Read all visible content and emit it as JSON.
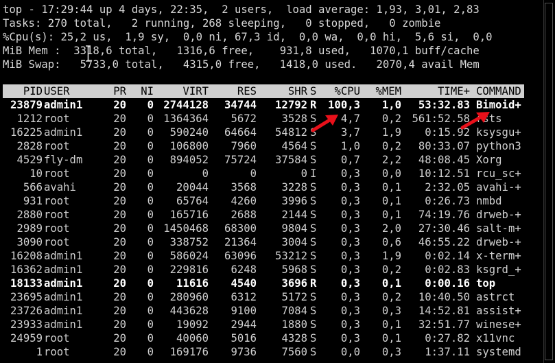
{
  "summary": {
    "line1": "top - 17:29:44 up 4 days, 22:35,  2 users,  load average: 1,93, 3,01, 2,83",
    "line2": "Tasks: 270 total,   2 running, 268 sleeping,   0 stopped,   0 zombie",
    "line3": "%Cpu(s): 25,2 us,  1,9 sy,  0,0 ni, 67,3 id,  0,0 wa,  0,0 hi,  5,6 si,  0,0",
    "line4": "MiB Mem :  3318,6 total,   1316,6 free,    931,8 used,   1070,1 buff/cache",
    "line5": "MiB Swap:   5733,0 total,   4315,0 free,   1418,0 used.   2070,4 avail Mem"
  },
  "columns": {
    "pid": "PID",
    "user": "USER",
    "pr": "PR",
    "ni": "NI",
    "virt": "VIRT",
    "res": "RES",
    "shr": "SHR",
    "s": "S",
    "cpu": "%CPU",
    "mem": "%MEM",
    "time": "TIME+",
    "command": "COMMAND"
  },
  "processes": [
    {
      "pid": "23879",
      "user": "admin1",
      "pr": "20",
      "ni": "0",
      "virt": "2744128",
      "res": "34744",
      "shr": "12792",
      "s": "R",
      "cpu": "100,3",
      "mem": "1,0",
      "time": "53:32.83",
      "command": "Bimoid+",
      "bold": true
    },
    {
      "pid": "1212",
      "user": "root",
      "pr": "20",
      "ni": "0",
      "virt": "1364364",
      "res": "5672",
      "shr": "3528",
      "s": "S",
      "cpu": "4,7",
      "mem": "0,2",
      "time": "561:52.58",
      "command": "rsts",
      "bold": false
    },
    {
      "pid": "16225",
      "user": "admin1",
      "pr": "20",
      "ni": "0",
      "virt": "590240",
      "res": "64664",
      "shr": "54812",
      "s": "S",
      "cpu": "3,7",
      "mem": "1,9",
      "time": "0:15.92",
      "command": "ksysgu+",
      "bold": false
    },
    {
      "pid": "2828",
      "user": "root",
      "pr": "20",
      "ni": "0",
      "virt": "106800",
      "res": "7960",
      "shr": "4564",
      "s": "S",
      "cpu": "1,0",
      "mem": "0,2",
      "time": "80:33.07",
      "command": "python3",
      "bold": false
    },
    {
      "pid": "4529",
      "user": "fly-dm",
      "pr": "20",
      "ni": "0",
      "virt": "894052",
      "res": "75724",
      "shr": "37584",
      "s": "S",
      "cpu": "0,7",
      "mem": "2,2",
      "time": "48:08.45",
      "command": "Xorg",
      "bold": false
    },
    {
      "pid": "10",
      "user": "root",
      "pr": "20",
      "ni": "0",
      "virt": "0",
      "res": "0",
      "shr": "0",
      "s": "I",
      "cpu": "0,3",
      "mem": "0,0",
      "time": "10:12.51",
      "command": "rcu_sc+",
      "bold": false
    },
    {
      "pid": "566",
      "user": "avahi",
      "pr": "20",
      "ni": "0",
      "virt": "20044",
      "res": "3568",
      "shr": "3228",
      "s": "S",
      "cpu": "0,3",
      "mem": "0,1",
      "time": "2:32.05",
      "command": "avahi-+",
      "bold": false
    },
    {
      "pid": "931",
      "user": "root",
      "pr": "20",
      "ni": "0",
      "virt": "65764",
      "res": "4260",
      "shr": "3996",
      "s": "S",
      "cpu": "0,3",
      "mem": "0,1",
      "time": "0:26.73",
      "command": "nmbd",
      "bold": false
    },
    {
      "pid": "2880",
      "user": "root",
      "pr": "20",
      "ni": "0",
      "virt": "165716",
      "res": "2688",
      "shr": "2144",
      "s": "S",
      "cpu": "0,3",
      "mem": "0,1",
      "time": "74:19.76",
      "command": "drweb-+",
      "bold": false
    },
    {
      "pid": "2989",
      "user": "root",
      "pr": "20",
      "ni": "0",
      "virt": "1450468",
      "res": "68300",
      "shr": "9804",
      "s": "S",
      "cpu": "0,3",
      "mem": "2,0",
      "time": "27:30.46",
      "command": "salt-m+",
      "bold": false
    },
    {
      "pid": "3090",
      "user": "root",
      "pr": "20",
      "ni": "0",
      "virt": "338752",
      "res": "21364",
      "shr": "3004",
      "s": "S",
      "cpu": "0,3",
      "mem": "0,6",
      "time": "46:55.22",
      "command": "drweb-+",
      "bold": false
    },
    {
      "pid": "16208",
      "user": "admin1",
      "pr": "20",
      "ni": "0",
      "virt": "586024",
      "res": "63096",
      "shr": "53212",
      "s": "S",
      "cpu": "0,3",
      "mem": "1,9",
      "time": "0:02.14",
      "command": "x-term+",
      "bold": false
    },
    {
      "pid": "16362",
      "user": "admin1",
      "pr": "20",
      "ni": "0",
      "virt": "229816",
      "res": "6248",
      "shr": "5968",
      "s": "S",
      "cpu": "0,3",
      "mem": "0,2",
      "time": "0:02.83",
      "command": "ksgrd_+",
      "bold": false
    },
    {
      "pid": "18133",
      "user": "admin1",
      "pr": "20",
      "ni": "0",
      "virt": "11616",
      "res": "4540",
      "shr": "3696",
      "s": "R",
      "cpu": "0,3",
      "mem": "0,1",
      "time": "0:00.16",
      "command": "top",
      "bold": true
    },
    {
      "pid": "23695",
      "user": "admin1",
      "pr": "20",
      "ni": "0",
      "virt": "280960",
      "res": "6312",
      "shr": "5172",
      "s": "S",
      "cpu": "0,3",
      "mem": "0,2",
      "time": "10:40.50",
      "command": "astrct",
      "bold": false
    },
    {
      "pid": "23726",
      "user": "admin1",
      "pr": "20",
      "ni": "0",
      "virt": "443628",
      "res": "9100",
      "shr": "7084",
      "s": "S",
      "cpu": "0,3",
      "mem": "0,3",
      "time": "14:52.81",
      "command": "assist+",
      "bold": false
    },
    {
      "pid": "23933",
      "user": "admin1",
      "pr": "20",
      "ni": "0",
      "virt": "19092",
      "res": "2944",
      "shr": "1880",
      "s": "S",
      "cpu": "0,3",
      "mem": "0,1",
      "time": "32:51.77",
      "command": "winese+",
      "bold": false
    },
    {
      "pid": "24959",
      "user": "root",
      "pr": "20",
      "ni": "0",
      "virt": "40060",
      "res": "5016",
      "shr": "4328",
      "s": "S",
      "cpu": "0,3",
      "mem": "0,1",
      "time": "0:27.82",
      "command": "x11vnc",
      "bold": false
    },
    {
      "pid": "1",
      "user": "root",
      "pr": "20",
      "ni": "0",
      "virt": "169176",
      "res": "9736",
      "shr": "7560",
      "s": "S",
      "cpu": "0,0",
      "mem": "0,3",
      "time": "1:37.11",
      "command": "systemd",
      "bold": false
    }
  ],
  "colors": {
    "background": "#000000",
    "text": "#d8d8d8",
    "header_bg": "#d0d0d0",
    "arrow": "#e8101a"
  },
  "icons": {
    "arrow1": "red-arrow-icon",
    "arrow2": "red-arrow-icon",
    "cursor": "ibeam-cursor-icon"
  }
}
